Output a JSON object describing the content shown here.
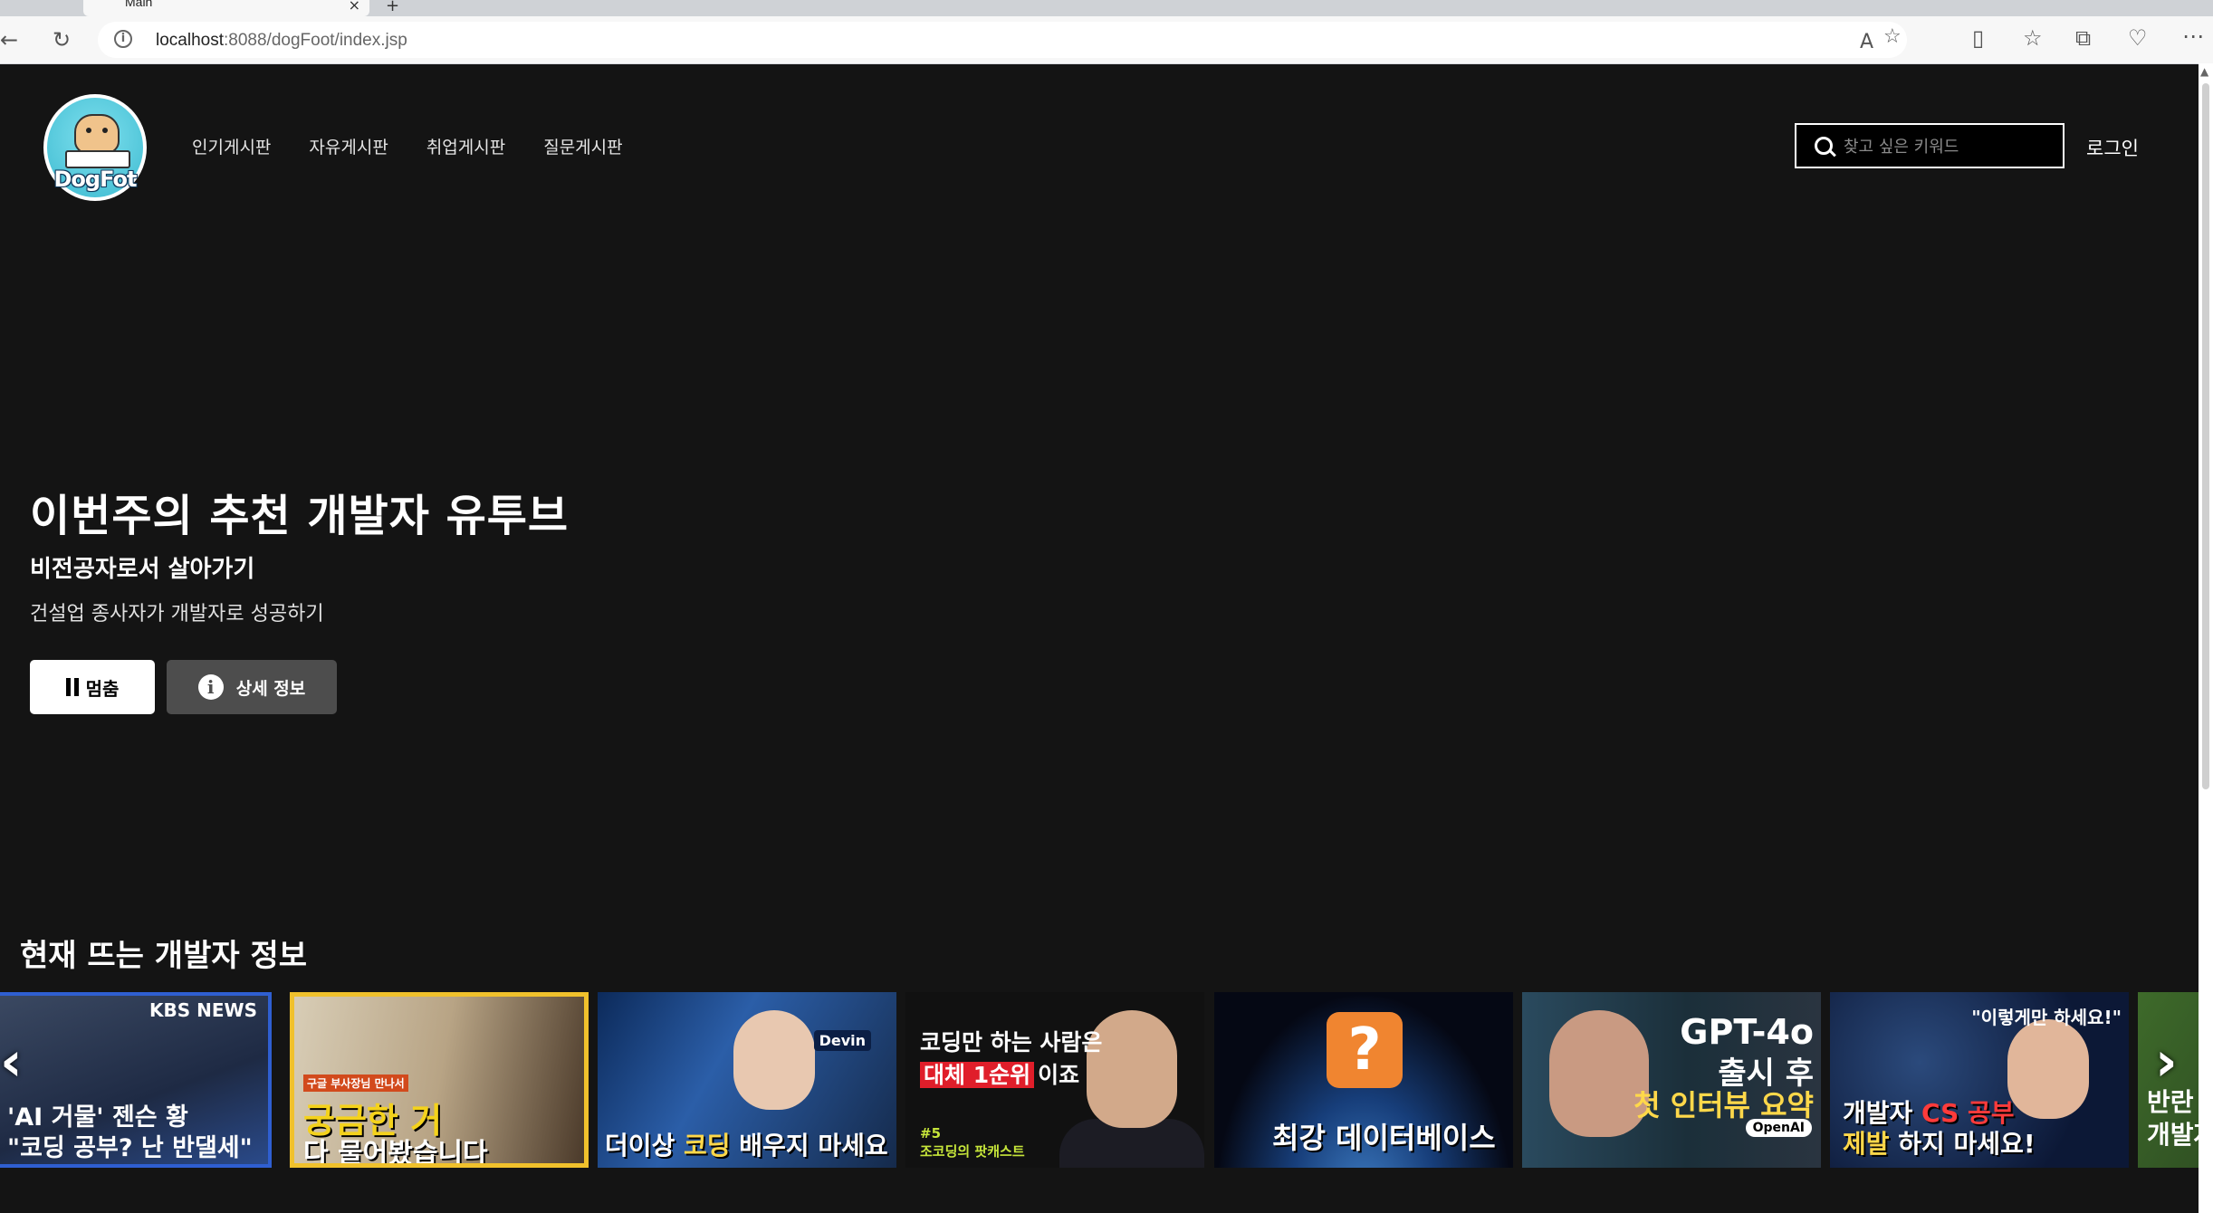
{
  "browser": {
    "tab_title": "Main",
    "url_host": "localhost",
    "url_rest": ":8088/dogFoot/index.jsp"
  },
  "site": {
    "logo_text": "DogFot",
    "nav": [
      "인기게시판",
      "자유게시판",
      "취업게시판",
      "질문게시판"
    ],
    "search_placeholder": "찾고 싶은 키워드",
    "login_label": "로그인"
  },
  "hero": {
    "title": "이번주의 추천 개발자 유투브",
    "subtitle": "비전공자로서 살아가기",
    "description": "건설업 종사자가 개발자로 성공하기",
    "pause_label": "멈춤",
    "info_label": "상세 정보"
  },
  "trending": {
    "title": "현재 뜨는 개발자 정보",
    "thumbnails": [
      {
        "line1": "'AI 거물' 젠슨 황",
        "line2": "\"코딩 공부? 난 반댈세\"",
        "badge": "KBS NEWS"
      },
      {
        "line1": "구글 부사장님 만나서",
        "line2": "궁금한 거",
        "line3": "다 물어봤습니다"
      },
      {
        "line1a": "더이상 ",
        "line1b": "코딩",
        "line1c": " 배우지 마세요",
        "badge": "Devin"
      },
      {
        "line1": "코딩만 하는 사람은",
        "line2a": "대체 1순위",
        "line2b": "이죠",
        "line3a": "#5",
        "line3b": "조코딩의 팟캐스트"
      },
      {
        "box": "?",
        "line1": "최강 데이터베이스"
      },
      {
        "line1": "GPT-4o",
        "line2": "출시 후",
        "line3": "첫 인터뷰 요약",
        "badge": "OpenAI"
      },
      {
        "line1": "\"이렇게만 하세요!\"",
        "line2a": "개발자 ",
        "line2b": "CS 공부",
        "line3a": "제발",
        "line3b": " 하지 마세요!"
      },
      {
        "line1": "반란",
        "line2": "개발자"
      }
    ]
  },
  "colors": {
    "background": "#141414",
    "accent_yellow": "#ffd84a",
    "accent_red": "#e01e2a"
  }
}
